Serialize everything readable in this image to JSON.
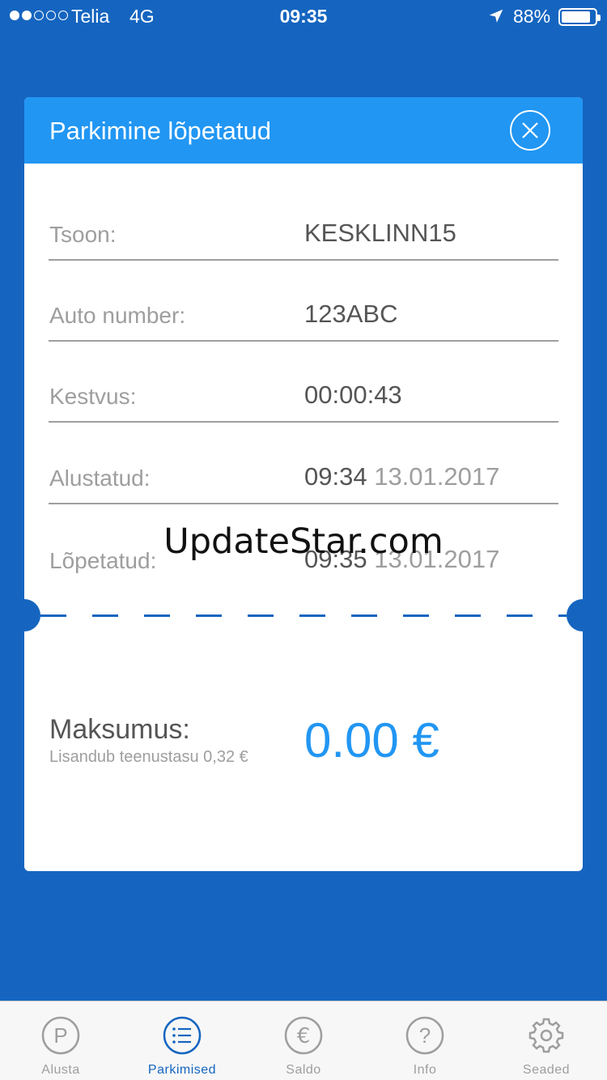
{
  "status_bar": {
    "carrier": "Telia",
    "network": "4G",
    "time": "09:35",
    "battery": "88%",
    "battery_level": 0.88
  },
  "card": {
    "title": "Parkimine lõpetatud",
    "rows": [
      {
        "label": "Tsoon:",
        "value": "KESKLINN15",
        "date": ""
      },
      {
        "label": "Auto number:",
        "value": "123ABC",
        "date": ""
      },
      {
        "label": "Kestvus:",
        "value": "00:00:43",
        "date": ""
      },
      {
        "label": "Alustatud:",
        "value": "09:34",
        "date": "13.01.2017"
      },
      {
        "label": "Lõpetatud:",
        "value": "09:35",
        "date": "13.01.2017"
      }
    ],
    "watermark": "UpdateStar.com",
    "cost": {
      "label": "Maksumus:",
      "note": "Lisandub teenustasu 0,32 €",
      "value": "0.00 €"
    }
  },
  "tabs": [
    {
      "label": "Alusta",
      "icon": "parking-icon",
      "active": false
    },
    {
      "label": "Parkimised",
      "icon": "list-icon",
      "active": true
    },
    {
      "label": "Saldo",
      "icon": "euro-icon",
      "active": false
    },
    {
      "label": "Info",
      "icon": "question-icon",
      "active": false
    },
    {
      "label": "Seaded",
      "icon": "gear-icon",
      "active": false
    }
  ],
  "colors": {
    "background": "#1565c0",
    "header": "#2196f3",
    "accent": "#2196f3",
    "active_tab": "#1565c0"
  }
}
